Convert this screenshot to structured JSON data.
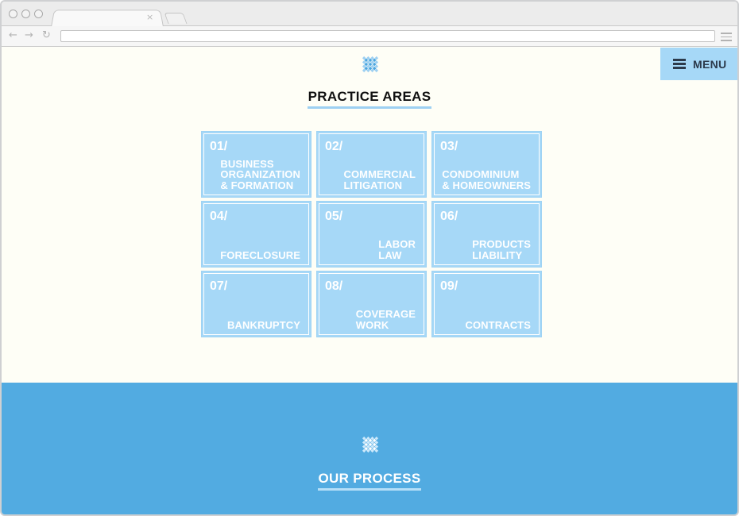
{
  "header": {
    "menu_label": "MENU"
  },
  "practice_areas": {
    "title": "PRACTICE AREAS",
    "items": [
      {
        "num": "01/",
        "label": "BUSINESS\nORGANIZATION\n& FORMATION"
      },
      {
        "num": "02/",
        "label": "COMMERCIAL\nLITIGATION"
      },
      {
        "num": "03/",
        "label": "CONDOMINIUM\n& HOMEOWNERS"
      },
      {
        "num": "04/",
        "label": "FORECLOSURE"
      },
      {
        "num": "05/",
        "label": "LABOR\nLAW"
      },
      {
        "num": "06/",
        "label": "PRODUCTS\nLIABILITY"
      },
      {
        "num": "07/",
        "label": "BANKRUPTCY"
      },
      {
        "num": "08/",
        "label": "COVERAGE\nWORK"
      },
      {
        "num": "09/",
        "label": "CONTRACTS"
      }
    ]
  },
  "process": {
    "title": "OUR PROCESS"
  },
  "colors": {
    "accent": "#a6d8f7",
    "band": "#52abe1",
    "logo": "#4aa5e0"
  },
  "icons": {
    "logo": "diamond-logo-icon",
    "menu": "hamburger-icon"
  }
}
